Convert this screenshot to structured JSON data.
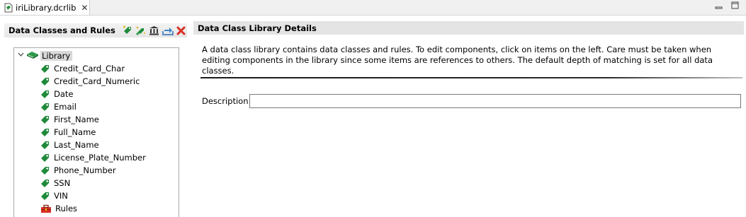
{
  "editor_tab": {
    "title": "iriLibrary.dcrlib",
    "close_glyph": "✕"
  },
  "window_controls": {
    "minimize": "▭",
    "maximize": "▭"
  },
  "left_panel": {
    "title": "Data Classes and Rules",
    "toolbar": [
      {
        "name": "add-data-class-button",
        "icon": "tag-add-icon"
      },
      {
        "name": "add-rule-button",
        "icon": "tags-add-icon"
      },
      {
        "name": "library-button",
        "icon": "library-building-icon"
      },
      {
        "name": "import-button",
        "icon": "import-tray-icon"
      },
      {
        "name": "delete-button",
        "icon": "red-x-delete-icon"
      }
    ],
    "tree": {
      "root_label": "Library",
      "items": [
        {
          "label": "Credit_Card_Char",
          "icon": "tag-icon"
        },
        {
          "label": "Credit_Card_Numeric",
          "icon": "tag-icon"
        },
        {
          "label": "Date",
          "icon": "tag-icon"
        },
        {
          "label": "Email",
          "icon": "tag-icon"
        },
        {
          "label": "First_Name",
          "icon": "tag-icon"
        },
        {
          "label": "Full_Name",
          "icon": "tag-icon"
        },
        {
          "label": "Last_Name",
          "icon": "tag-icon"
        },
        {
          "label": "License_Plate_Number",
          "icon": "tag-icon"
        },
        {
          "label": "Phone_Number",
          "icon": "tag-icon"
        },
        {
          "label": "SSN",
          "icon": "tag-icon"
        },
        {
          "label": "VIN",
          "icon": "tag-icon"
        },
        {
          "label": "Rules",
          "icon": "toolbox-icon"
        }
      ]
    }
  },
  "details": {
    "title": "Data Class Library Details",
    "description_text": "A data class library contains data classes and rules. To edit components, click on items on the left. Care must be taken when editing components in the library since some items are references to others. The default depth of matching is set for all data classes.",
    "description_label": "Description:",
    "description_value": ""
  },
  "colors": {
    "tag_green": "#1f8a3a",
    "delete_red": "#d93025",
    "header_gray": "#e4e4e4"
  }
}
